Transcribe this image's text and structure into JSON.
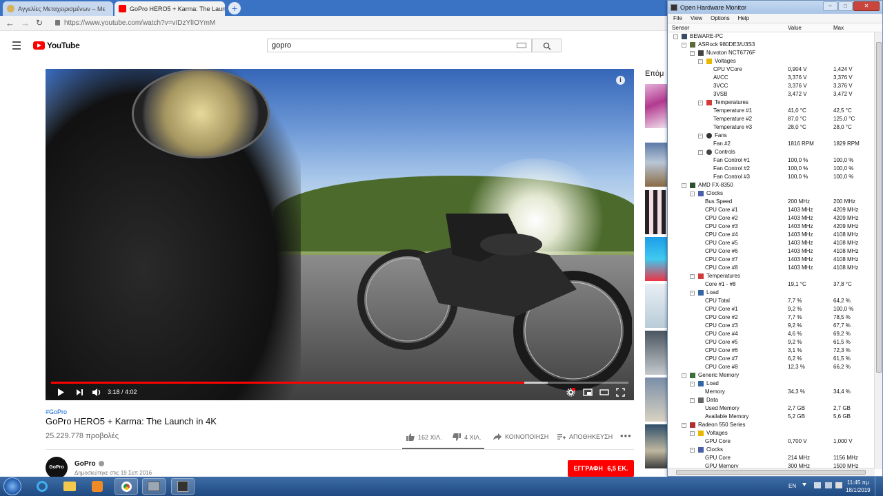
{
  "browser": {
    "tabs": [
      {
        "title": "Αγγελίες Μεταχειρισμένων – Με",
        "active": false
      },
      {
        "title": "GoPro HERO5 + Karma: The Launc",
        "active": true
      }
    ],
    "url": "https://www.youtube.com/watch?v=vIDzYlIOYmM"
  },
  "youtube": {
    "logo_text": "YouTube",
    "search_value": "gopro",
    "video": {
      "time_display": "3:18 / 4:02",
      "progress_fraction": 0.82,
      "buffered_fraction": 0.86
    },
    "hashtag": "#GoPro",
    "title": "GoPro HERO5 + Karma: The Launch in 4K",
    "views": "25.229.778 προβολές",
    "actions": {
      "likes": "162 ΧΙΛ.",
      "dislikes": "4 ΧΙΛ.",
      "share": "ΚΟΙΝΟΠΟΙΗΣΗ",
      "save": "ΑΠΟΘΗΚΕΥΣΗ"
    },
    "channel": {
      "name": "GoPro",
      "avatar_text": "GoPro",
      "published": "Δημοσιεύτηκε στις 19 Σεπ 2016",
      "subscribe_label": "ΕΓΓΡΑΦΗ",
      "subscriber_count": "6,5 ΕΚ."
    },
    "up_next_label": "Επόμ"
  },
  "ohm": {
    "title": "Open Hardware Monitor",
    "menu": [
      "File",
      "View",
      "Options",
      "Help"
    ],
    "columns": {
      "sensor": "Sensor",
      "value": "Value",
      "max": "Max"
    },
    "rows": [
      {
        "level": 0,
        "toggle": "-",
        "icon": "pc-icon",
        "name": "BEWARE-PC",
        "value": "",
        "max": ""
      },
      {
        "level": 1,
        "toggle": "-",
        "icon": "motherboard-icon",
        "name": "ASRock 980DE3/U3S3",
        "value": "",
        "max": ""
      },
      {
        "level": 2,
        "toggle": "-",
        "icon": "chip-icon",
        "name": "Nuvoton NCT6776F",
        "value": "",
        "max": ""
      },
      {
        "level": 3,
        "toggle": "-",
        "icon": "voltage-icon",
        "name": "Voltages",
        "value": "",
        "max": ""
      },
      {
        "level": 4,
        "toggle": "",
        "icon": "",
        "name": "CPU VCore",
        "value": "0,904 V",
        "max": "1,424 V"
      },
      {
        "level": 4,
        "toggle": "",
        "icon": "",
        "name": "AVCC",
        "value": "3,376 V",
        "max": "3,376 V"
      },
      {
        "level": 4,
        "toggle": "",
        "icon": "",
        "name": "3VCC",
        "value": "3,376 V",
        "max": "3,376 V"
      },
      {
        "level": 4,
        "toggle": "",
        "icon": "",
        "name": "3VSB",
        "value": "3,472 V",
        "max": "3,472 V"
      },
      {
        "level": 3,
        "toggle": "-",
        "icon": "thermometer-icon",
        "name": "Temperatures",
        "value": "",
        "max": ""
      },
      {
        "level": 4,
        "toggle": "",
        "icon": "",
        "name": "Temperature #1",
        "value": "41,0 °C",
        "max": "42,5 °C"
      },
      {
        "level": 4,
        "toggle": "",
        "icon": "",
        "name": "Temperature #2",
        "value": "87,0 °C",
        "max": "125,0 °C"
      },
      {
        "level": 4,
        "toggle": "",
        "icon": "",
        "name": "Temperature #3",
        "value": "28,0 °C",
        "max": "28,0 °C"
      },
      {
        "level": 3,
        "toggle": "-",
        "icon": "fan-icon",
        "name": "Fans",
        "value": "",
        "max": ""
      },
      {
        "level": 4,
        "toggle": "",
        "icon": "",
        "name": "Fan #2",
        "value": "1816 RPM",
        "max": "1829 RPM"
      },
      {
        "level": 3,
        "toggle": "-",
        "icon": "control-icon",
        "name": "Controls",
        "value": "",
        "max": ""
      },
      {
        "level": 4,
        "toggle": "",
        "icon": "",
        "name": "Fan Control #1",
        "value": "100,0 %",
        "max": "100,0 %"
      },
      {
        "level": 4,
        "toggle": "",
        "icon": "",
        "name": "Fan Control #2",
        "value": "100,0 %",
        "max": "100,0 %"
      },
      {
        "level": 4,
        "toggle": "",
        "icon": "",
        "name": "Fan Control #3",
        "value": "100,0 %",
        "max": "100,0 %"
      },
      {
        "level": 1,
        "toggle": "-",
        "icon": "cpu-icon",
        "name": "AMD FX-8350",
        "value": "",
        "max": ""
      },
      {
        "level": 2,
        "toggle": "-",
        "icon": "clock-icon",
        "name": "Clocks",
        "value": "",
        "max": ""
      },
      {
        "level": 3,
        "toggle": "",
        "icon": "",
        "name": "Bus Speed",
        "value": "200 MHz",
        "max": "200 MHz"
      },
      {
        "level": 3,
        "toggle": "",
        "icon": "",
        "name": "CPU Core #1",
        "value": "1403 MHz",
        "max": "4209 MHz"
      },
      {
        "level": 3,
        "toggle": "",
        "icon": "",
        "name": "CPU Core #2",
        "value": "1403 MHz",
        "max": "4209 MHz"
      },
      {
        "level": 3,
        "toggle": "",
        "icon": "",
        "name": "CPU Core #3",
        "value": "1403 MHz",
        "max": "4209 MHz"
      },
      {
        "level": 3,
        "toggle": "",
        "icon": "",
        "name": "CPU Core #4",
        "value": "1403 MHz",
        "max": "4108 MHz"
      },
      {
        "level": 3,
        "toggle": "",
        "icon": "",
        "name": "CPU Core #5",
        "value": "1403 MHz",
        "max": "4108 MHz"
      },
      {
        "level": 3,
        "toggle": "",
        "icon": "",
        "name": "CPU Core #6",
        "value": "1403 MHz",
        "max": "4108 MHz"
      },
      {
        "level": 3,
        "toggle": "",
        "icon": "",
        "name": "CPU Core #7",
        "value": "1403 MHz",
        "max": "4108 MHz"
      },
      {
        "level": 3,
        "toggle": "",
        "icon": "",
        "name": "CPU Core #8",
        "value": "1403 MHz",
        "max": "4108 MHz"
      },
      {
        "level": 2,
        "toggle": "-",
        "icon": "thermometer-icon",
        "name": "Temperatures",
        "value": "",
        "max": ""
      },
      {
        "level": 3,
        "toggle": "",
        "icon": "",
        "name": "Core #1 - #8",
        "value": "19,1 °C",
        "max": "37,8 °C"
      },
      {
        "level": 2,
        "toggle": "-",
        "icon": "load-icon",
        "name": "Load",
        "value": "",
        "max": ""
      },
      {
        "level": 3,
        "toggle": "",
        "icon": "",
        "name": "CPU Total",
        "value": "7,7 %",
        "max": "64,2 %"
      },
      {
        "level": 3,
        "toggle": "",
        "icon": "",
        "name": "CPU Core #1",
        "value": "9,2 %",
        "max": "100,0 %"
      },
      {
        "level": 3,
        "toggle": "",
        "icon": "",
        "name": "CPU Core #2",
        "value": "7,7 %",
        "max": "78,5 %"
      },
      {
        "level": 3,
        "toggle": "",
        "icon": "",
        "name": "CPU Core #3",
        "value": "9,2 %",
        "max": "67,7 %"
      },
      {
        "level": 3,
        "toggle": "",
        "icon": "",
        "name": "CPU Core #4",
        "value": "4,6 %",
        "max": "69,2 %"
      },
      {
        "level": 3,
        "toggle": "",
        "icon": "",
        "name": "CPU Core #5",
        "value": "9,2 %",
        "max": "61,5 %"
      },
      {
        "level": 3,
        "toggle": "",
        "icon": "",
        "name": "CPU Core #6",
        "value": "3,1 %",
        "max": "72,3 %"
      },
      {
        "level": 3,
        "toggle": "",
        "icon": "",
        "name": "CPU Core #7",
        "value": "6,2 %",
        "max": "61,5 %"
      },
      {
        "level": 3,
        "toggle": "",
        "icon": "",
        "name": "CPU Core #8",
        "value": "12,3 %",
        "max": "66,2 %"
      },
      {
        "level": 1,
        "toggle": "-",
        "icon": "memory-icon",
        "name": "Generic Memory",
        "value": "",
        "max": ""
      },
      {
        "level": 2,
        "toggle": "-",
        "icon": "load-icon",
        "name": "Load",
        "value": "",
        "max": ""
      },
      {
        "level": 3,
        "toggle": "",
        "icon": "",
        "name": "Memory",
        "value": "34,3 %",
        "max": "34,4 %"
      },
      {
        "level": 2,
        "toggle": "-",
        "icon": "data-icon",
        "name": "Data",
        "value": "",
        "max": ""
      },
      {
        "level": 3,
        "toggle": "",
        "icon": "",
        "name": "Used Memory",
        "value": "2,7 GB",
        "max": "2,7 GB"
      },
      {
        "level": 3,
        "toggle": "",
        "icon": "",
        "name": "Available Memory",
        "value": "5,2 GB",
        "max": "5,6 GB"
      },
      {
        "level": 1,
        "toggle": "-",
        "icon": "gpu-icon",
        "name": "Radeon 550 Series",
        "value": "",
        "max": ""
      },
      {
        "level": 2,
        "toggle": "-",
        "icon": "voltage-icon",
        "name": "Voltages",
        "value": "",
        "max": ""
      },
      {
        "level": 3,
        "toggle": "",
        "icon": "",
        "name": "GPU Core",
        "value": "0,700 V",
        "max": "1,000 V"
      },
      {
        "level": 2,
        "toggle": "-",
        "icon": "clock-icon",
        "name": "Clocks",
        "value": "",
        "max": ""
      },
      {
        "level": 3,
        "toggle": "",
        "icon": "",
        "name": "GPU Core",
        "value": "214 MHz",
        "max": "1156 MHz"
      },
      {
        "level": 3,
        "toggle": "",
        "icon": "",
        "name": "GPU Memory",
        "value": "300 MHz",
        "max": "1500 MHz"
      }
    ]
  },
  "taskbar": {
    "language": "EN",
    "time": "11:45 πμ",
    "date": "18/1/2019"
  },
  "colors": {
    "youtube_red": "#ff0000",
    "link_blue": "#065fd4",
    "taskbar": "#2a5a96",
    "ohm_border": "#6d8fb8"
  }
}
